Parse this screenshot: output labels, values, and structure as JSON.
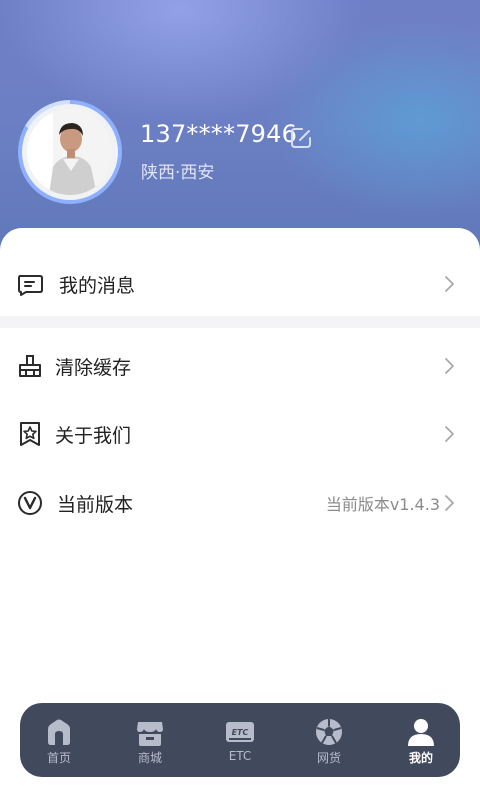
{
  "profile": {
    "phone": "137****7946",
    "location": "陕西·西安"
  },
  "menu": {
    "messages": {
      "label": "我的消息",
      "icon": "message-icon"
    },
    "clear_cache": {
      "label": "清除缓存",
      "icon": "broom-icon"
    },
    "about": {
      "label": "关于我们",
      "icon": "badge-star-icon"
    },
    "version": {
      "label": "当前版本",
      "value": "当前版本v1.4.3",
      "icon": "version-v-icon"
    }
  },
  "tabs": [
    {
      "label": "首页",
      "icon": "home-icon"
    },
    {
      "label": "商城",
      "icon": "store-icon"
    },
    {
      "label": "ETC",
      "icon": "etc-card-icon"
    },
    {
      "label": "网货",
      "icon": "ball-icon"
    },
    {
      "label": "我的",
      "icon": "person-icon",
      "active": true
    }
  ],
  "colors": {
    "header_gradient": "#6f7fc6",
    "tabbar_bg": "#41495d",
    "tab_inactive": "#b7bccb",
    "tab_active": "#ffffff"
  }
}
